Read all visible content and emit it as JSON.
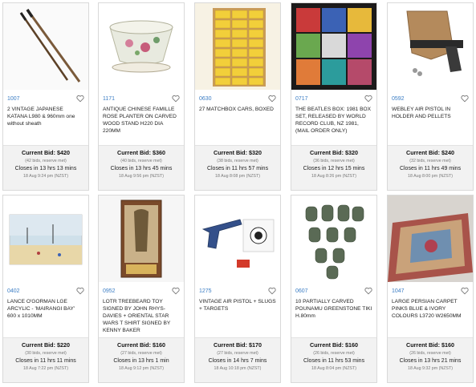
{
  "cards": [
    {
      "lot": "1007",
      "title": "2 VINTAGE JAPANESE KATANA L980 & 960mm one without sheath",
      "bid": "Current Bid: $420",
      "meta": "(42 bids, reserve met)",
      "closes": "Closes in 13 hrs 13 mins",
      "date": "18 Aug 9:24 pm (NZST)",
      "image": "katana-swords-image"
    },
    {
      "lot": "1171",
      "title": "ANTIQUE CHINESE FAMILLE ROSE PLANTER ON CARVED WOOD STAND H220 DIA 220MM",
      "bid": "Current Bid: $360",
      "meta": "(40 bids, reserve met)",
      "closes": "Closes in 13 hrs 45 mins",
      "date": "18 Aug 9:56 pm (NZST)",
      "image": "chinese-planter-image"
    },
    {
      "lot": "0630",
      "title": "27 MATCHBOX CARS, BOXED",
      "bid": "Current Bid: $320",
      "meta": "(38 bids, reserve met)",
      "closes": "Closes in 11 hrs 57 mins",
      "date": "18 Aug 8:08 pm (NZST)",
      "image": "matchbox-cars-image"
    },
    {
      "lot": "0717",
      "title": "THE BEATLES BOX: 1981 BOX SET, RELEASED BY WORLD RECORD CLUB, NZ 1981, (MAIL ORDER ONLY)",
      "bid": "Current Bid: $320",
      "meta": "(36 bids, reserve met)",
      "closes": "Closes in 12 hrs 15 mins",
      "date": "18 Aug 8:26 pm (NZST)",
      "image": "beatles-box-image"
    },
    {
      "lot": "0592",
      "title": "WEBLEY AIR PISTOL IN HOLDER AND PELLETS",
      "bid": "Current Bid: $240",
      "meta": "(32 bids, reserve met)",
      "closes": "Closes in 11 hrs 49 mins",
      "date": "18 Aug 8:00 pm (NZST)",
      "image": "webley-pistol-image"
    },
    {
      "lot": "0402",
      "title": "LANCE O'GORMAN LGE ARCYLIC - 'MAIRANGI BAY' 600 x 1010MM",
      "bid": "Current Bid: $220",
      "meta": "(30 bids, reserve met)",
      "closes": "Closes in 11 hrs 11 mins",
      "date": "18 Aug 7:22 pm (NZST)",
      "image": "painting-image"
    },
    {
      "lot": "0952",
      "title": "LOTR TREEBEARD TOY SIGNED BY JOHN RHYS-DAVIES + ORIENTAL STAR WARS T SHIRT SIGNED BY KENNY BAKER",
      "bid": "Current Bid: $160",
      "meta": "(27 bids, reserve met)",
      "closes": "Closes in 13 hrs 1 min",
      "date": "18 Aug 9:12 pm (NZST)",
      "image": "treebeard-toy-image"
    },
    {
      "lot": "1275",
      "title": "VINTAGE AIR PISTOL + SLUGS + TARGETS",
      "bid": "Current Bid: $170",
      "meta": "(27 bids, reserve met)",
      "closes": "Closes in 14 hrs 7 mins",
      "date": "18 Aug 10:18 pm (NZST)",
      "image": "air-pistol-target-image"
    },
    {
      "lot": "0607",
      "title": "10 PARTIALLY CARVED POUNAMU GREENSTONE TIKI H.80mm",
      "bid": "Current Bid: $160",
      "meta": "(26 bids, reserve met)",
      "closes": "Closes in 11 hrs 53 mins",
      "date": "18 Aug 8:04 pm (NZST)",
      "image": "greenstone-tiki-image"
    },
    {
      "lot": "1047",
      "title": "LARGE PERSIAN CARPET PINKS BLUE & IVORY COLOURS L3720 W2650MM",
      "bid": "Current Bid: $160",
      "meta": "(26 bids, reserve met)",
      "closes": "Closes in 13 hrs 21 mins",
      "date": "18 Aug 9:32 pm (NZST)",
      "image": "persian-carpet-image"
    }
  ]
}
